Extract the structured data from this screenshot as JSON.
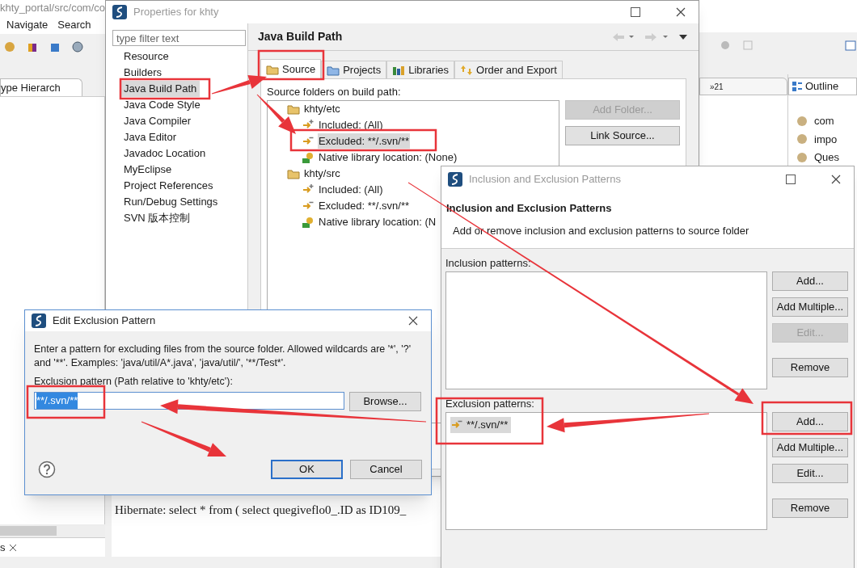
{
  "ide": {
    "title": "khty_portal/src/com/co",
    "menu": [
      "Navigate",
      "Search"
    ],
    "left_view": {
      "tab": "ype Hierarch"
    },
    "bottom_left_view": {
      "tab": "s"
    },
    "overflow_tab": {
      "label": "»21"
    },
    "outline": {
      "tab": "Outline",
      "items": [
        "com",
        "impo",
        "Ques"
      ]
    },
    "console": {
      "lines": [
        "Hibernate: select * from ( select quegiveflo0_.ID as ID109_"
      ]
    }
  },
  "properties_dialog": {
    "title": "Properties for khty",
    "active": false,
    "filter": {
      "placeholder": "type filter text"
    },
    "pages": [
      {
        "label": "Resource",
        "selected": false
      },
      {
        "label": "Builders",
        "selected": false
      },
      {
        "label": "Java Build Path",
        "selected": true
      },
      {
        "label": "Java Code Style",
        "selected": false
      },
      {
        "label": "Java Compiler",
        "selected": false
      },
      {
        "label": "Java Editor",
        "selected": false
      },
      {
        "label": "Javadoc Location",
        "selected": false
      },
      {
        "label": "MyEclipse",
        "selected": false
      },
      {
        "label": "Project References",
        "selected": false
      },
      {
        "label": "Run/Debug Settings",
        "selected": false
      },
      {
        "label": "SVN 版本控制",
        "selected": false
      }
    ],
    "page_title": "Java Build Path",
    "tabs": [
      {
        "label": "Source",
        "kind": "source",
        "selected": true
      },
      {
        "label": "Projects",
        "kind": "projects",
        "selected": false
      },
      {
        "label": "Libraries",
        "kind": "libraries",
        "selected": false
      },
      {
        "label": "Order and Export",
        "kind": "order",
        "selected": false
      }
    ],
    "tree_label": "Source folders on build path:",
    "tree": [
      {
        "label": "khty/etc",
        "kind": "folder",
        "selected": false,
        "children": [
          {
            "label": "Included: (All)",
            "kind": "included",
            "selected": false
          },
          {
            "label": "Excluded: **/.svn/**",
            "kind": "excluded",
            "selected": true
          },
          {
            "label": "Native library location: (None)",
            "kind": "native",
            "selected": false
          }
        ]
      },
      {
        "label": "khty/src",
        "kind": "folder",
        "selected": false,
        "children": [
          {
            "label": "Included: (All)",
            "kind": "included",
            "selected": false
          },
          {
            "label": "Excluded: **/.svn/**",
            "kind": "excluded",
            "selected": false
          },
          {
            "label": "Native library location: (N",
            "kind": "native",
            "selected": false
          }
        ]
      }
    ],
    "buttons": [
      {
        "label": "Add Folder...",
        "disabled": true
      },
      {
        "label": "Link Source...",
        "disabled": false
      }
    ]
  },
  "patterns_dialog": {
    "title": "Inclusion and Exclusion Patterns",
    "active": false,
    "heading": "Inclusion and Exclusion Patterns",
    "description": "Add or remove inclusion and exclusion patterns to source folder",
    "inclusion": {
      "label": "Inclusion patterns:",
      "buttons": [
        {
          "label": "Add...",
          "disabled": false
        },
        {
          "label": "Add Multiple...",
          "disabled": false
        },
        {
          "label": "Edit...",
          "disabled": true
        },
        {
          "label": "Remove",
          "disabled": false
        }
      ]
    },
    "exclusion": {
      "label": "Exclusion patterns:",
      "items": [
        {
          "label": "**/.svn/**",
          "selected": true
        }
      ],
      "buttons": [
        {
          "label": "Add...",
          "disabled": false
        },
        {
          "label": "Add Multiple...",
          "disabled": false
        },
        {
          "label": "Edit...",
          "disabled": false
        },
        {
          "label": "Remove",
          "disabled": false
        }
      ]
    }
  },
  "edit_dialog": {
    "title": "Edit Exclusion Pattern",
    "active": true,
    "description": "Enter a pattern for excluding files from the source folder. Allowed wildcards are '*', '?' and '**'. Examples: 'java/util/A*.java', 'java/util/', '**/Test*'.",
    "field_label": "Exclusion pattern (Path relative to 'khty/etc'):",
    "field": {
      "value": "**/.svn/**",
      "value_selected": true
    },
    "buttons": [
      {
        "label": "Browse...",
        "kind": "browse",
        "default": false
      },
      {
        "label": "OK",
        "kind": "ok",
        "default": true
      },
      {
        "label": "Cancel",
        "kind": "cancel",
        "default": false
      }
    ]
  }
}
